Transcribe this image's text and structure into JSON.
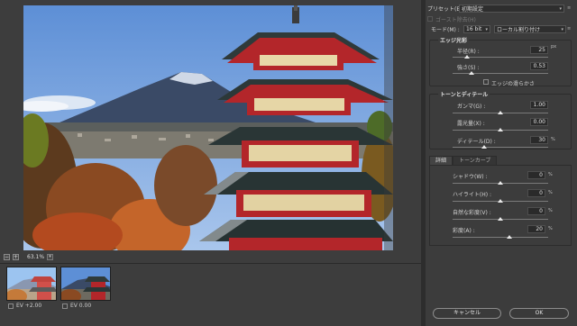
{
  "preview": {
    "zoom": "63.1%",
    "zoom_minus": "−",
    "zoom_plus": "+"
  },
  "thumbnails": [
    {
      "label": "EV +2.00"
    },
    {
      "label": "EV 0.00"
    }
  ],
  "panel": {
    "preset_label": "プリセット(E) :",
    "preset_value": "初期設定",
    "ghost_label": "ゴースト除去(H)",
    "mode_label": "モード(M) :",
    "bit_value": "16 bit",
    "method_value": "ローカル割り付け",
    "edge": {
      "title": "エッジ光彩",
      "radius_label": "半径(R) :",
      "radius_value": "25",
      "radius_unit": "px",
      "strength_label": "強さ(S) :",
      "strength_value": "0.53",
      "smooth_label": "エッジの滑らかさ"
    },
    "tone": {
      "title": "トーンとディテール",
      "gamma_label": "ガンマ(G) :",
      "gamma_value": "1.00",
      "exposure_label": "露光量(X) :",
      "exposure_value": "0.00",
      "detail_label": "ディテール(D) :",
      "detail_value": "30",
      "detail_unit": "%"
    },
    "tabs": {
      "detail": "詳細",
      "curve": "トーンカーブ"
    },
    "adv": {
      "shadow_label": "シャドウ(W) :",
      "shadow_value": "0",
      "shadow_unit": "%",
      "highlight_label": "ハイライト(H) :",
      "highlight_value": "0",
      "highlight_unit": "%",
      "vibrance_label": "自然な彩度(V) :",
      "vibrance_value": "0",
      "vibrance_unit": "%",
      "saturation_label": "彩度(A) :",
      "saturation_value": "20",
      "saturation_unit": "%"
    },
    "cancel": "キャンセル",
    "ok": "OK"
  },
  "colors": {
    "accent_select": "#2e2e2e",
    "panel_bg": "#3c3c3c",
    "sky": "#6a9ad8",
    "pagoda_red": "#b3262a"
  },
  "icons": [
    "minus-icon",
    "plus-icon",
    "dropdown-arrow-icon",
    "settings-icon",
    "pin-icon",
    "checkbox-icon"
  ]
}
